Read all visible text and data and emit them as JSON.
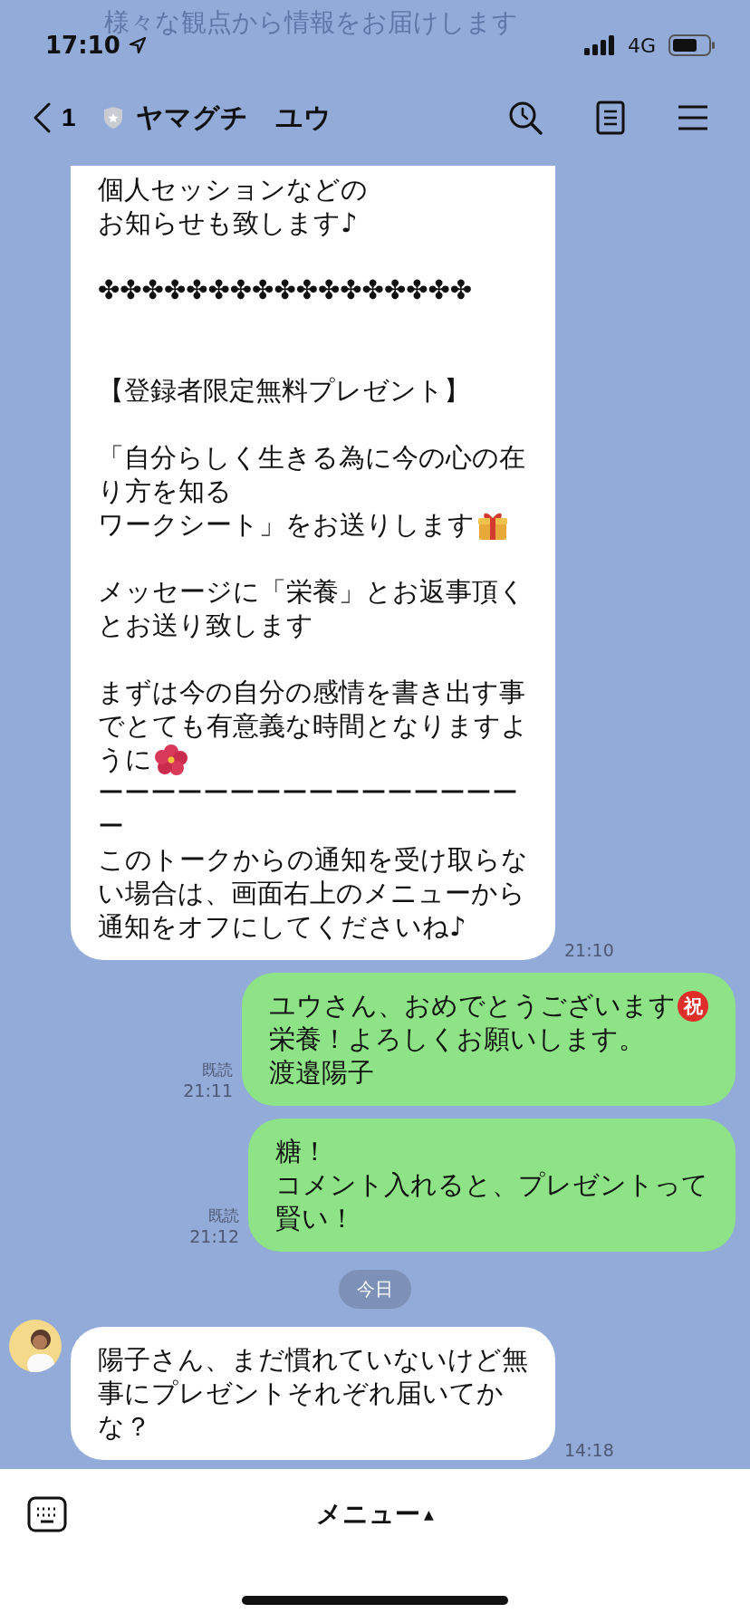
{
  "status_bar": {
    "time": "17:10",
    "network": "4G"
  },
  "behind_header_text": "様々な観点から情報をお届けします",
  "header": {
    "back_count": "1",
    "title": "ヤマグチ　ユウ"
  },
  "messages": [
    {
      "kind": "incoming",
      "avatar": false,
      "time": "21:10",
      "lines": [
        {
          "kind": "text",
          "text": "個人セッションなどの"
        },
        {
          "kind": "text",
          "text": "お知らせも致します♪"
        },
        {
          "kind": "blank"
        },
        {
          "kind": "text",
          "text": "✤✤✤✤✤✤✤✤✤✤✤✤✤✤✤✤✤"
        },
        {
          "kind": "blank"
        },
        {
          "kind": "blank"
        },
        {
          "kind": "text",
          "text": "【登録者限定無料プレゼント】"
        },
        {
          "kind": "blank"
        },
        {
          "kind": "text",
          "text": "「自分らしく生きる為に今の心の在"
        },
        {
          "kind": "text",
          "text": "り方を知る"
        },
        {
          "kind": "text_with_gift",
          "text": "ワークシート」をお送りします"
        },
        {
          "kind": "blank"
        },
        {
          "kind": "text",
          "text": "メッセージに「栄養」とお返事頂く"
        },
        {
          "kind": "text",
          "text": "とお送り致します"
        },
        {
          "kind": "blank"
        },
        {
          "kind": "text",
          "text": "まずは今の自分の感情を書き出す事"
        },
        {
          "kind": "text",
          "text": "でとても有意義な時間となりますよ"
        },
        {
          "kind": "text_with_hibiscus",
          "text": "うに"
        },
        {
          "kind": "text",
          "text": "ーーーーーーーーーーーーーーーー"
        },
        {
          "kind": "text",
          "text": "ー"
        },
        {
          "kind": "text",
          "text": "このトークからの通知を受け取らな"
        },
        {
          "kind": "text",
          "text": "い場合は、画面右上のメニューから"
        },
        {
          "kind": "text",
          "text": "通知をオフにしてくださいね♪"
        }
      ]
    },
    {
      "kind": "outgoing",
      "read": "既読",
      "time": "21:11",
      "lines": [
        {
          "kind": "text",
          "text": "ユウさん、おめでとうございます",
          "badge": "祝"
        },
        {
          "kind": "text",
          "text": "栄養！よろしくお願いします。"
        },
        {
          "kind": "text",
          "text": "渡邉陽子"
        }
      ]
    },
    {
      "kind": "outgoing",
      "read": "既読",
      "time": "21:12",
      "lines": [
        {
          "kind": "text",
          "text": "糖！"
        },
        {
          "kind": "text",
          "text": "コメント入れると、プレゼントって"
        },
        {
          "kind": "text",
          "text": "賢い！"
        }
      ]
    },
    {
      "kind": "date",
      "text": "今日"
    },
    {
      "kind": "incoming",
      "avatar": true,
      "time": "14:18",
      "lines": [
        {
          "kind": "text",
          "text": "陽子さん、まだ慣れていないけど無"
        },
        {
          "kind": "text",
          "text": "事にプレゼントそれぞれ届いてか"
        },
        {
          "kind": "text",
          "text": "な？"
        }
      ]
    }
  ],
  "footer": {
    "menu_label": "メニュー",
    "menu_caret": "▲"
  }
}
